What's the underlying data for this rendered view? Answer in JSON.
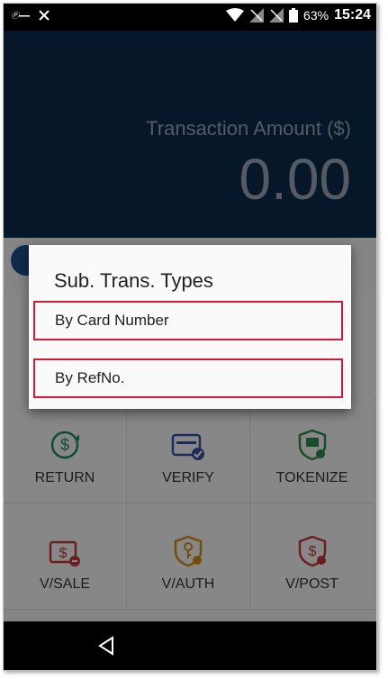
{
  "status_bar": {
    "battery": "63%",
    "time": "15:24"
  },
  "header": {
    "amount_label": "Transaction Amount ($)",
    "amount_value": "0.00"
  },
  "dialog": {
    "title": "Sub. Trans. Types",
    "options": [
      {
        "label": "By Card Number"
      },
      {
        "label": "By RefNo."
      }
    ]
  },
  "grid": {
    "tiles": [
      {
        "label": "RETURN",
        "icon": "dollar-cycle-icon",
        "color": "#1a8a6a"
      },
      {
        "label": "VERIFY",
        "icon": "card-check-icon",
        "color": "#3a4fa8"
      },
      {
        "label": "TOKENIZE",
        "icon": "shield-token-icon",
        "color": "#2f8a4a"
      },
      {
        "label": "V/SALE",
        "icon": "dollar-card-icon",
        "color": "#c0393b"
      },
      {
        "label": "V/AUTH",
        "icon": "key-shield-icon",
        "color": "#d88a1b"
      },
      {
        "label": "V/POST",
        "icon": "dollar-shield-icon",
        "color": "#c0393b"
      }
    ]
  },
  "colors": {
    "header_bg": "#0e2a4e",
    "highlight": "#d4193b"
  }
}
